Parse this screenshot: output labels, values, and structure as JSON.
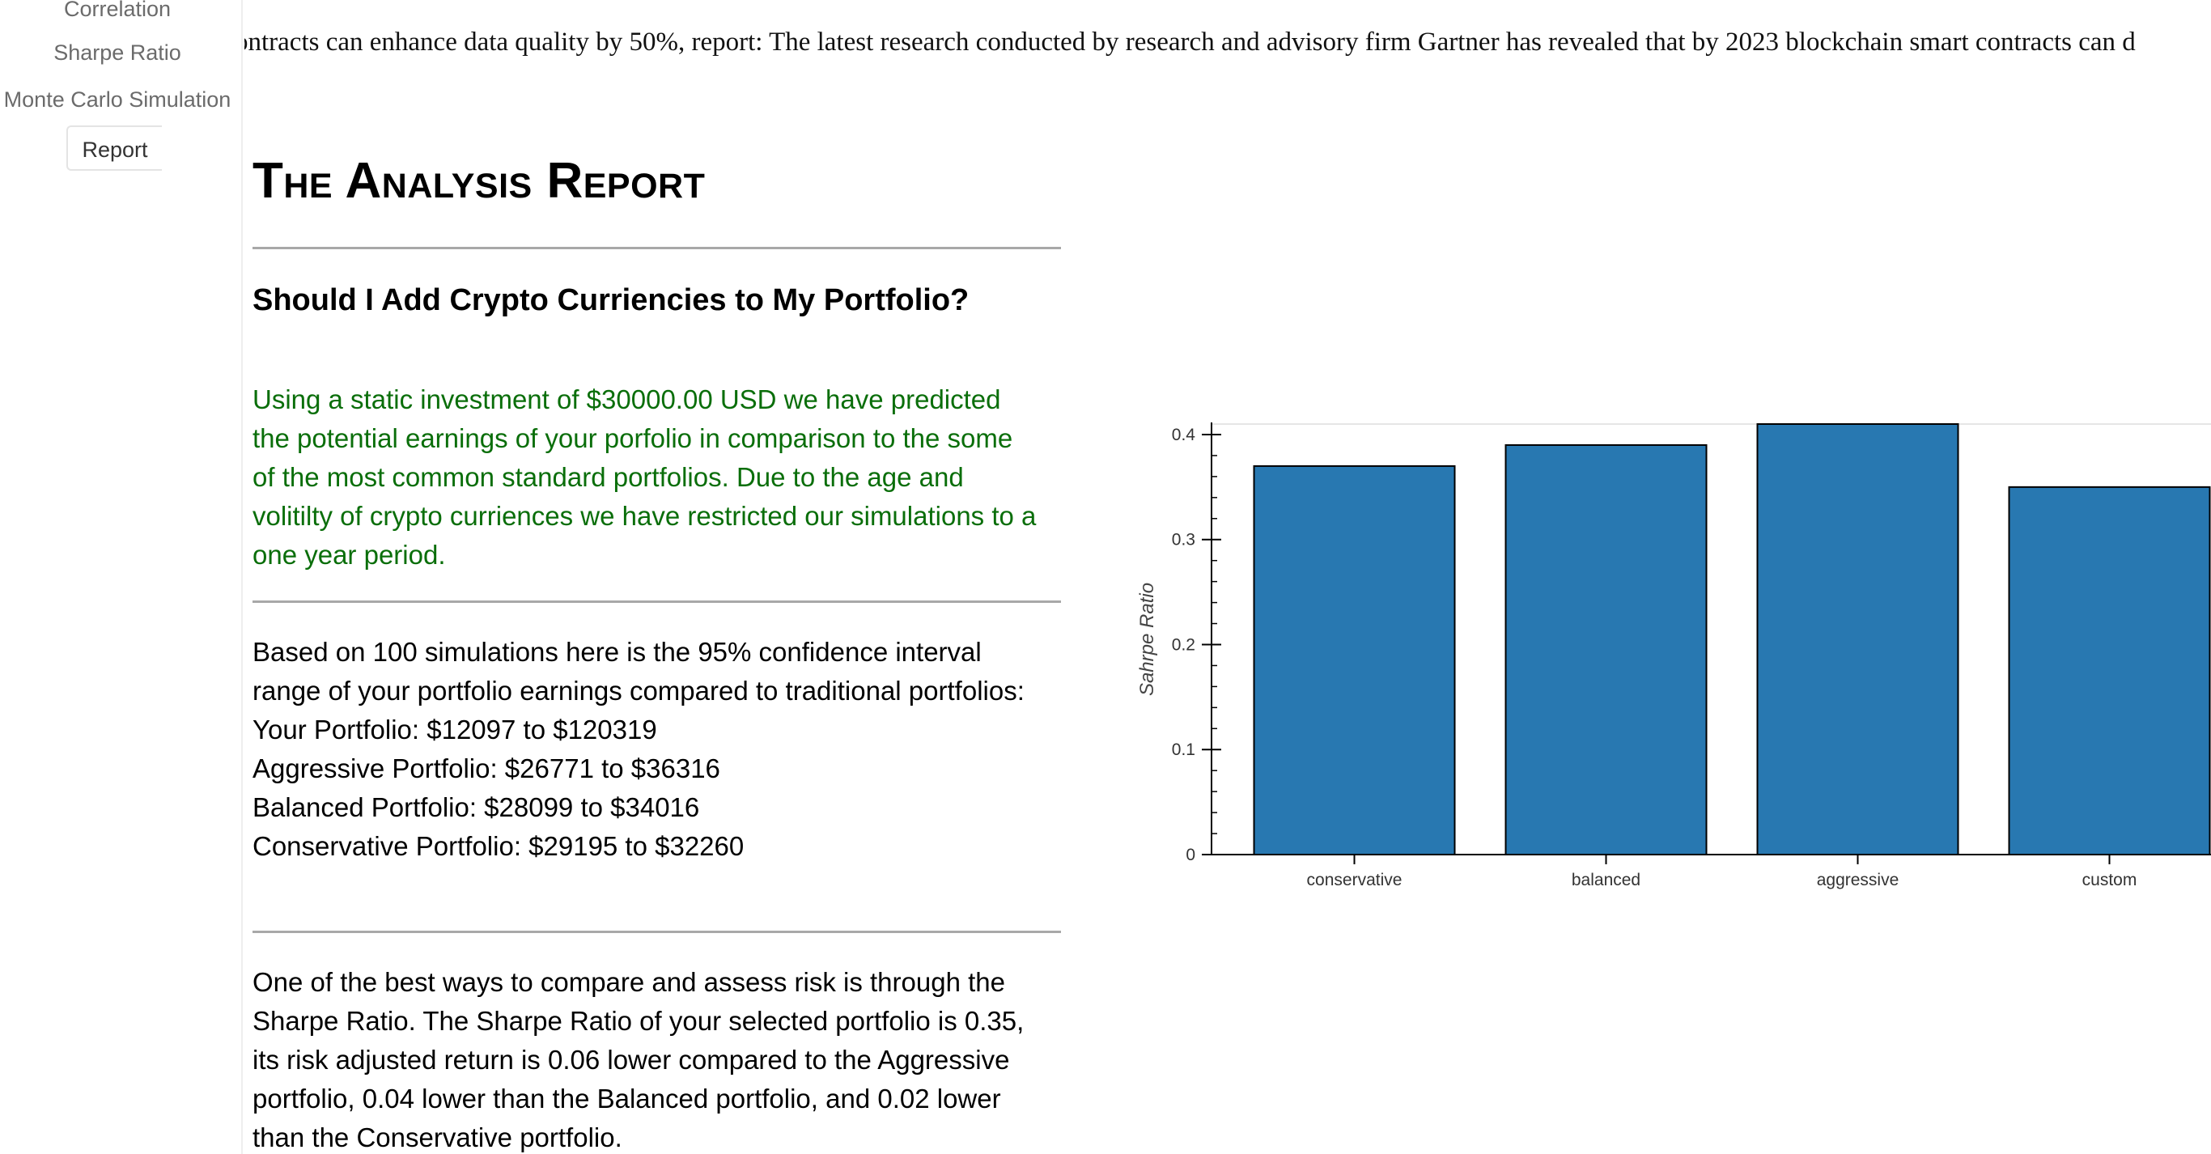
{
  "sidebar": {
    "items": [
      {
        "label": "Correlation",
        "active": false
      },
      {
        "label": "Sharpe Ratio",
        "active": false
      },
      {
        "label": "Monte Carlo Simulation",
        "active": false
      },
      {
        "label": "Report",
        "active": true
      }
    ]
  },
  "ticker": {
    "text": "ontracts can enhance data quality by 50%, report: The latest research conducted by research and advisory firm Gartner has revealed that by 2023 blockchain smart contracts can d"
  },
  "report": {
    "title": "The Analysis Report",
    "question": "Should I Add Crypto Curriencies to My Portfolio?",
    "intro_lines": [
      "Using a static investment of $30000.00 USD we have predicted",
      "the potential earnings of your porfolio in comparison to the some",
      "of the most common standard portfolios. Due to the age and",
      "volitilty of crypto curriences we have restricted our simulations to a",
      "one year period."
    ],
    "confidence_lines": [
      "Based on 100 simulations here is the 95% confidence interval",
      "range of your portfolio earnings compared to traditional portfolios:",
      "Your Portfolio: $12097 to $120319",
      "Aggressive Portfolio: $26771 to $36316",
      "Balanced Portfolio: $28099 to $34016",
      "Conservative Portfolio: $29195 to $32260"
    ],
    "sharpe_lines": [
      "One of the best ways to compare and assess risk is through the",
      "Sharpe Ratio. The Sharpe Ratio of your selected portfolio is 0.35,",
      "its risk adjusted return is 0.06 lower compared to the Aggressive",
      "portfolio, 0.04 lower than the Balanced portfolio, and 0.02 lower",
      "than the Conservative portfolio."
    ]
  },
  "colors": {
    "bar": "#2878b1",
    "intro_text": "#0a6e0a"
  },
  "chart_data": {
    "type": "bar",
    "categories": [
      "conservative",
      "balanced",
      "aggressive",
      "custom"
    ],
    "values": [
      0.37,
      0.39,
      0.41,
      0.35
    ],
    "ylabel": "Sahrpe Ratio",
    "xlabel": "",
    "ylim": [
      0,
      0.41
    ],
    "yticks": [
      "0",
      "0.1",
      "0.2",
      "0.3",
      "0.4"
    ],
    "grid": false
  }
}
